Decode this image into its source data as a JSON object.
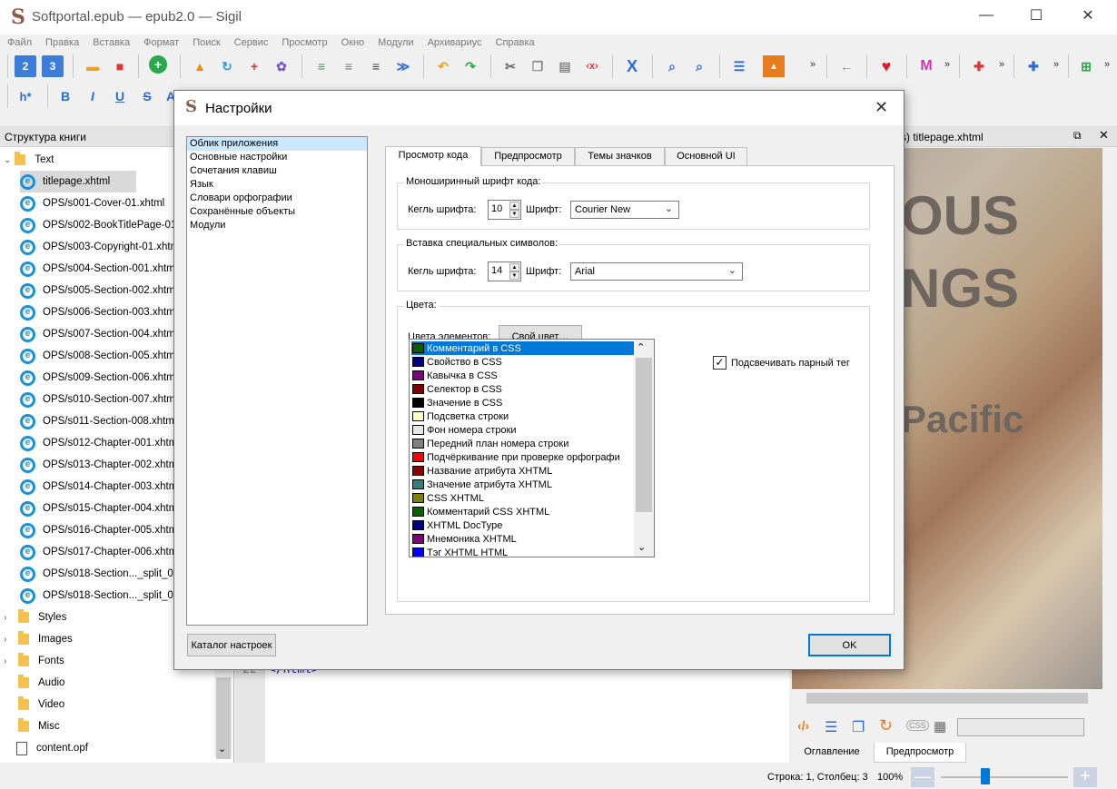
{
  "window": {
    "title": "Softportal.epub — epub2.0 — Sigil",
    "logo": "S",
    "minimize": "—",
    "maximize": "☐",
    "close": "✕"
  },
  "menu": [
    "Файл",
    "Правка",
    "Вставка",
    "Формат",
    "Поиск",
    "Сервис",
    "Просмотр",
    "Окно",
    "Модули",
    "Архивариус",
    "Справка"
  ],
  "left_panel": {
    "title": "Структура книги",
    "folders_top": {
      "text": "Text"
    },
    "files": [
      "titlepage.xhtml",
      "OPS/s001-Cover-01.xhtml",
      "OPS/s002-BookTitlePage-01.xhtml",
      "OPS/s003-Copyright-01.xhtml",
      "OPS/s004-Section-001.xhtml",
      "OPS/s005-Section-002.xhtml",
      "OPS/s006-Section-003.xhtml",
      "OPS/s007-Section-004.xhtml",
      "OPS/s008-Section-005.xhtml",
      "OPS/s009-Section-006.xhtml",
      "OPS/s010-Section-007.xhtml",
      "OPS/s011-Section-008.xhtml",
      "OPS/s012-Chapter-001.xhtml",
      "OPS/s013-Chapter-002.xhtml",
      "OPS/s014-Chapter-003.xhtml",
      "OPS/s015-Chapter-004.xhtml",
      "OPS/s016-Chapter-005.xhtml",
      "OPS/s017-Chapter-006.xhtml",
      "OPS/s018-Section..._split_000",
      "OPS/s018-Section..._split_001"
    ],
    "folders_bottom": [
      "Styles",
      "Images",
      "Fonts",
      "Audio",
      "Video",
      "Misc"
    ],
    "opf": "content.opf"
  },
  "editor": {
    "line_no": "22",
    "line_text": "</html>"
  },
  "right_panel": {
    "tab_title": "s) titlepage.xhtml",
    "image_text_1": "OUS",
    "image_text_2": "NGS",
    "image_text_3": "Pacific",
    "tabs": [
      "Оглавление",
      "Предпросмотр"
    ]
  },
  "status": {
    "position": "Строка: 1, Столбец: 3",
    "zoom": "100%",
    "zoom_level": 0.35
  },
  "dialog": {
    "title": "Настройки",
    "categories": [
      "Облик приложения",
      "Основные настройки",
      "Сочетания клавиш",
      "Язык",
      "Словари орфографии",
      "Сохранённые объекты",
      "Модули"
    ],
    "selected_category": 0,
    "tabs": [
      "Просмотр кода",
      "Предпросмотр",
      "Темы значков",
      "Основной UI"
    ],
    "mono_group": {
      "title": "Моноширинный шрифт кода:",
      "size_label": "Кегль шрифта:",
      "size": "10",
      "font_label": "Шрифт:",
      "font": "Courier New"
    },
    "special_group": {
      "title": "Вставка специальных символов:",
      "size_label": "Кегль шрифта:",
      "size": "14",
      "font_label": "Шрифт:",
      "font": "Arial"
    },
    "colors_group": {
      "title": "Цвета:",
      "elements_label": "Цвета элементов:",
      "custom_button": "Свой цвет…",
      "highlight_checkbox": "Подсвечивать парный тег",
      "highlight_checked": true,
      "items": [
        {
          "label": "Комментарий в CSS",
          "color": "#006400"
        },
        {
          "label": "Свойство в CSS",
          "color": "#00007f"
        },
        {
          "label": "Кавычка в CSS",
          "color": "#800080"
        },
        {
          "label": "Селектор в CSS",
          "color": "#800000"
        },
        {
          "label": "Значение в CSS",
          "color": "#000000"
        },
        {
          "label": "Подсветка строки",
          "color": "#ffffc0"
        },
        {
          "label": "Фон номера строки",
          "color": "#e6e6e6"
        },
        {
          "label": "Передний план номера строки",
          "color": "#808080"
        },
        {
          "label": "Подчёркивание при проверке орфографи",
          "color": "#ff0000"
        },
        {
          "label": "Название атрибута XHTML",
          "color": "#8b0000"
        },
        {
          "label": "Значение атрибута XHTML",
          "color": "#2f7f7f"
        },
        {
          "label": "CSS XHTML",
          "color": "#7f7f00"
        },
        {
          "label": "Комментарий CSS XHTML",
          "color": "#006400"
        },
        {
          "label": "XHTML DocType",
          "color": "#00007f"
        },
        {
          "label": "Мнемоника XHTML",
          "color": "#800080"
        },
        {
          "label": "Тэг XHTML HTML",
          "color": "#0000ff"
        }
      ]
    },
    "catalog_button": "Каталог настроек",
    "ok_button": "OK"
  }
}
